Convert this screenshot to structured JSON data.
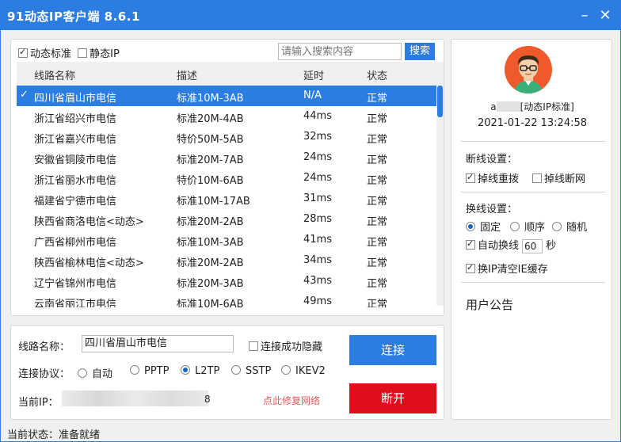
{
  "window": {
    "title": "91动态IP客户端 8.6.1",
    "minimize": "–",
    "close": "✕"
  },
  "mode": {
    "dynamic": {
      "label": "动态标准",
      "checked": true
    },
    "static": {
      "label": "静态IP",
      "checked": false
    }
  },
  "search": {
    "placeholder": "请输入搜索内容",
    "button": "搜索"
  },
  "table": {
    "headers": [
      "线路名称",
      "描述",
      "延时",
      "状态"
    ],
    "selected_mark": "✓",
    "rows": [
      {
        "name": "四川省眉山市电信",
        "desc": "标准10M-3AB",
        "latency": "N/A",
        "status": "正常",
        "selected": true
      },
      {
        "name": "浙江省绍兴市电信",
        "desc": "标准20M-4AB",
        "latency": "44ms",
        "status": "正常"
      },
      {
        "name": "浙江省嘉兴市电信",
        "desc": "特价50M-5AB",
        "latency": "32ms",
        "status": "正常"
      },
      {
        "name": "安徽省铜陵市电信",
        "desc": "标准20M-7AB",
        "latency": "24ms",
        "status": "正常"
      },
      {
        "name": "浙江省丽水市电信",
        "desc": "特价10M-6AB",
        "latency": "24ms",
        "status": "正常"
      },
      {
        "name": "福建省宁德市电信",
        "desc": "标准10M-17AB",
        "latency": "31ms",
        "status": "正常"
      },
      {
        "name": "陕西省商洛电信<动态>",
        "desc": "标准20M-2AB",
        "latency": "28ms",
        "status": "正常"
      },
      {
        "name": "广西省柳州市电信",
        "desc": "标准10M-3AB",
        "latency": "41ms",
        "status": "正常"
      },
      {
        "name": "陕西省榆林电信<动态>",
        "desc": "标准20M-2AB",
        "latency": "34ms",
        "status": "正常"
      },
      {
        "name": "辽宁省锦州市电信",
        "desc": "标准20M-3AB",
        "latency": "43ms",
        "status": "正常"
      },
      {
        "name": "云南省丽江市电信",
        "desc": "标准10M-6AB",
        "latency": "49ms",
        "status": "正常"
      }
    ]
  },
  "connection": {
    "route_label": "线路名称：",
    "route_value": "四川省眉山市电信",
    "hide_on_connect": {
      "label": "连接成功隐藏",
      "checked": false
    },
    "protocol_label": "连接协议：",
    "protocols": [
      {
        "label": "自动",
        "checked": false
      },
      {
        "label": "PPTP",
        "checked": false
      },
      {
        "label": "L2TP",
        "checked": true
      },
      {
        "label": "SSTP",
        "checked": false
      },
      {
        "label": "IKEV2",
        "checked": false
      }
    ],
    "ip_label": "当前IP：",
    "ip_suffix": "8",
    "repair_link": "点此修复网络",
    "connect_button": "连接",
    "disconnect_button": "断开"
  },
  "user": {
    "name_prefix": "a",
    "name_suffix": "[动态IP标准]",
    "datetime": "2021-01-22 13:24:58"
  },
  "disconnect_settings": {
    "title": "断线设置：",
    "reconnect": {
      "label": "掉线重拨",
      "checked": true
    },
    "break_network": {
      "label": "掉线断网",
      "checked": false
    }
  },
  "switch_settings": {
    "title": "换线设置：",
    "modes": [
      {
        "label": "固定",
        "checked": true
      },
      {
        "label": "顺序",
        "checked": false
      },
      {
        "label": "随机",
        "checked": false
      }
    ],
    "auto_switch": {
      "label": "自动换线",
      "checked": true,
      "value": "60",
      "unit": "秒"
    },
    "clear_cache": {
      "label": "换IP清空IE缓存",
      "checked": true
    }
  },
  "notice": {
    "title": "用户公告"
  },
  "status": {
    "text": "当前状态：准备就绪"
  }
}
